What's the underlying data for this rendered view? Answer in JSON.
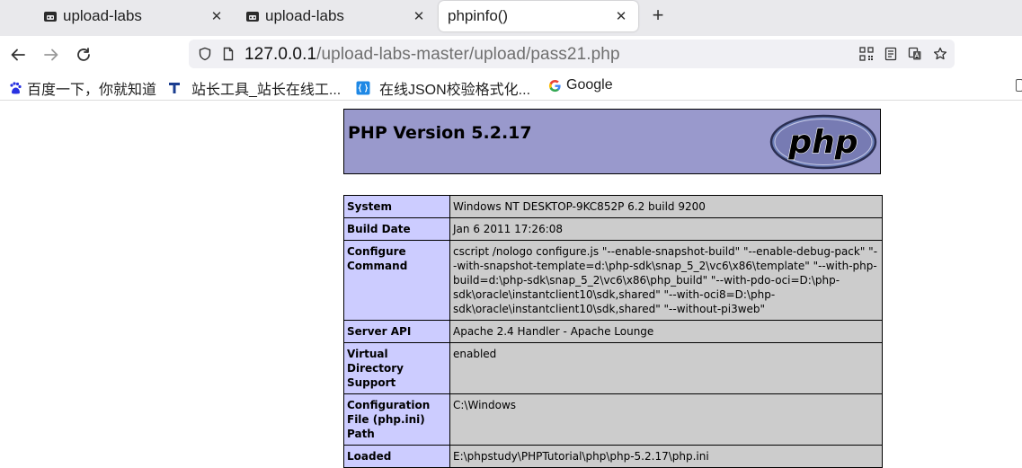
{
  "tabs": [
    {
      "label": "upload-labs",
      "active": false
    },
    {
      "label": "upload-labs",
      "active": false
    },
    {
      "label": "phpinfo()",
      "active": true
    }
  ],
  "nav": {
    "url_host": "127.0.0.1",
    "url_path": "/upload-labs-master/upload/pass21.php"
  },
  "bookmarks": [
    {
      "label": "百度一下，你就知道",
      "icon": "baidu-icon"
    },
    {
      "label": "站长工具_站长在线工...",
      "icon": "chinaz-icon"
    },
    {
      "label": "在线JSON校验格式化...",
      "icon": "json-icon"
    },
    {
      "label": "Google",
      "icon": "google-icon"
    }
  ],
  "phpinfo": {
    "version_title": "PHP Version 5.2.17",
    "logo_text": "php",
    "rows": [
      {
        "key": "System",
        "value": "Windows NT DESKTOP-9KC852P 6.2 build 9200"
      },
      {
        "key": "Build Date",
        "value": "Jan 6 2011 17:26:08"
      },
      {
        "key": "Configure Command",
        "value": "cscript /nologo configure.js \"--enable-snapshot-build\" \"--enable-debug-pack\" \"--with-snapshot-template=d:\\php-sdk\\snap_5_2\\vc6\\x86\\template\" \"--with-php-build=d:\\php-sdk\\snap_5_2\\vc6\\x86\\php_build\" \"--with-pdo-oci=D:\\php-sdk\\oracle\\instantclient10\\sdk,shared\" \"--with-oci8=D:\\php-sdk\\oracle\\instantclient10\\sdk,shared\" \"--without-pi3web\""
      },
      {
        "key": "Server API",
        "value": "Apache 2.4 Handler - Apache Lounge"
      },
      {
        "key": "Virtual Directory Support",
        "value": "enabled"
      },
      {
        "key": "Configuration File (php.ini) Path",
        "value": "C:\\Windows"
      },
      {
        "key": "Loaded",
        "value": "E:\\phpstudy\\PHPTutorial\\php\\php-5.2.17\\php.ini"
      }
    ]
  },
  "colors": {
    "header_bg": "#9999cc",
    "key_bg": "#ccccff",
    "value_bg": "#cccccc"
  }
}
